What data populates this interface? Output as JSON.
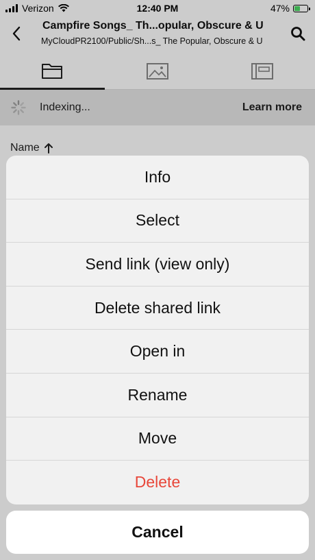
{
  "status_bar": {
    "carrier": "Verizon",
    "time": "12:40 PM",
    "battery": "47%",
    "battery_level": 0.47
  },
  "header": {
    "title": "Campfire Songs_ Th...opular, Obscure & U",
    "path": "MyCloudPR2100/Public/Sh...s_ The Popular, Obscure & U"
  },
  "tabs": [
    {
      "icon": "folder-icon",
      "active": true
    },
    {
      "icon": "image-icon",
      "active": false
    },
    {
      "icon": "album-icon",
      "active": false
    }
  ],
  "indexing": {
    "text": "Indexing...",
    "link": "Learn more"
  },
  "sort": {
    "label": "Name",
    "direction": "ascending"
  },
  "action_sheet": {
    "items": [
      {
        "label": "Info"
      },
      {
        "label": "Select"
      },
      {
        "label": "Send link (view only)"
      },
      {
        "label": "Delete shared link"
      },
      {
        "label": "Open in"
      },
      {
        "label": "Rename"
      },
      {
        "label": "Move"
      },
      {
        "label": "Delete",
        "destructive": true
      }
    ],
    "cancel_label": "Cancel"
  },
  "colors": {
    "destructive": "#e8473a",
    "sheet_bg": "#f1f1f1",
    "index_bar": "#e6e6e6"
  }
}
